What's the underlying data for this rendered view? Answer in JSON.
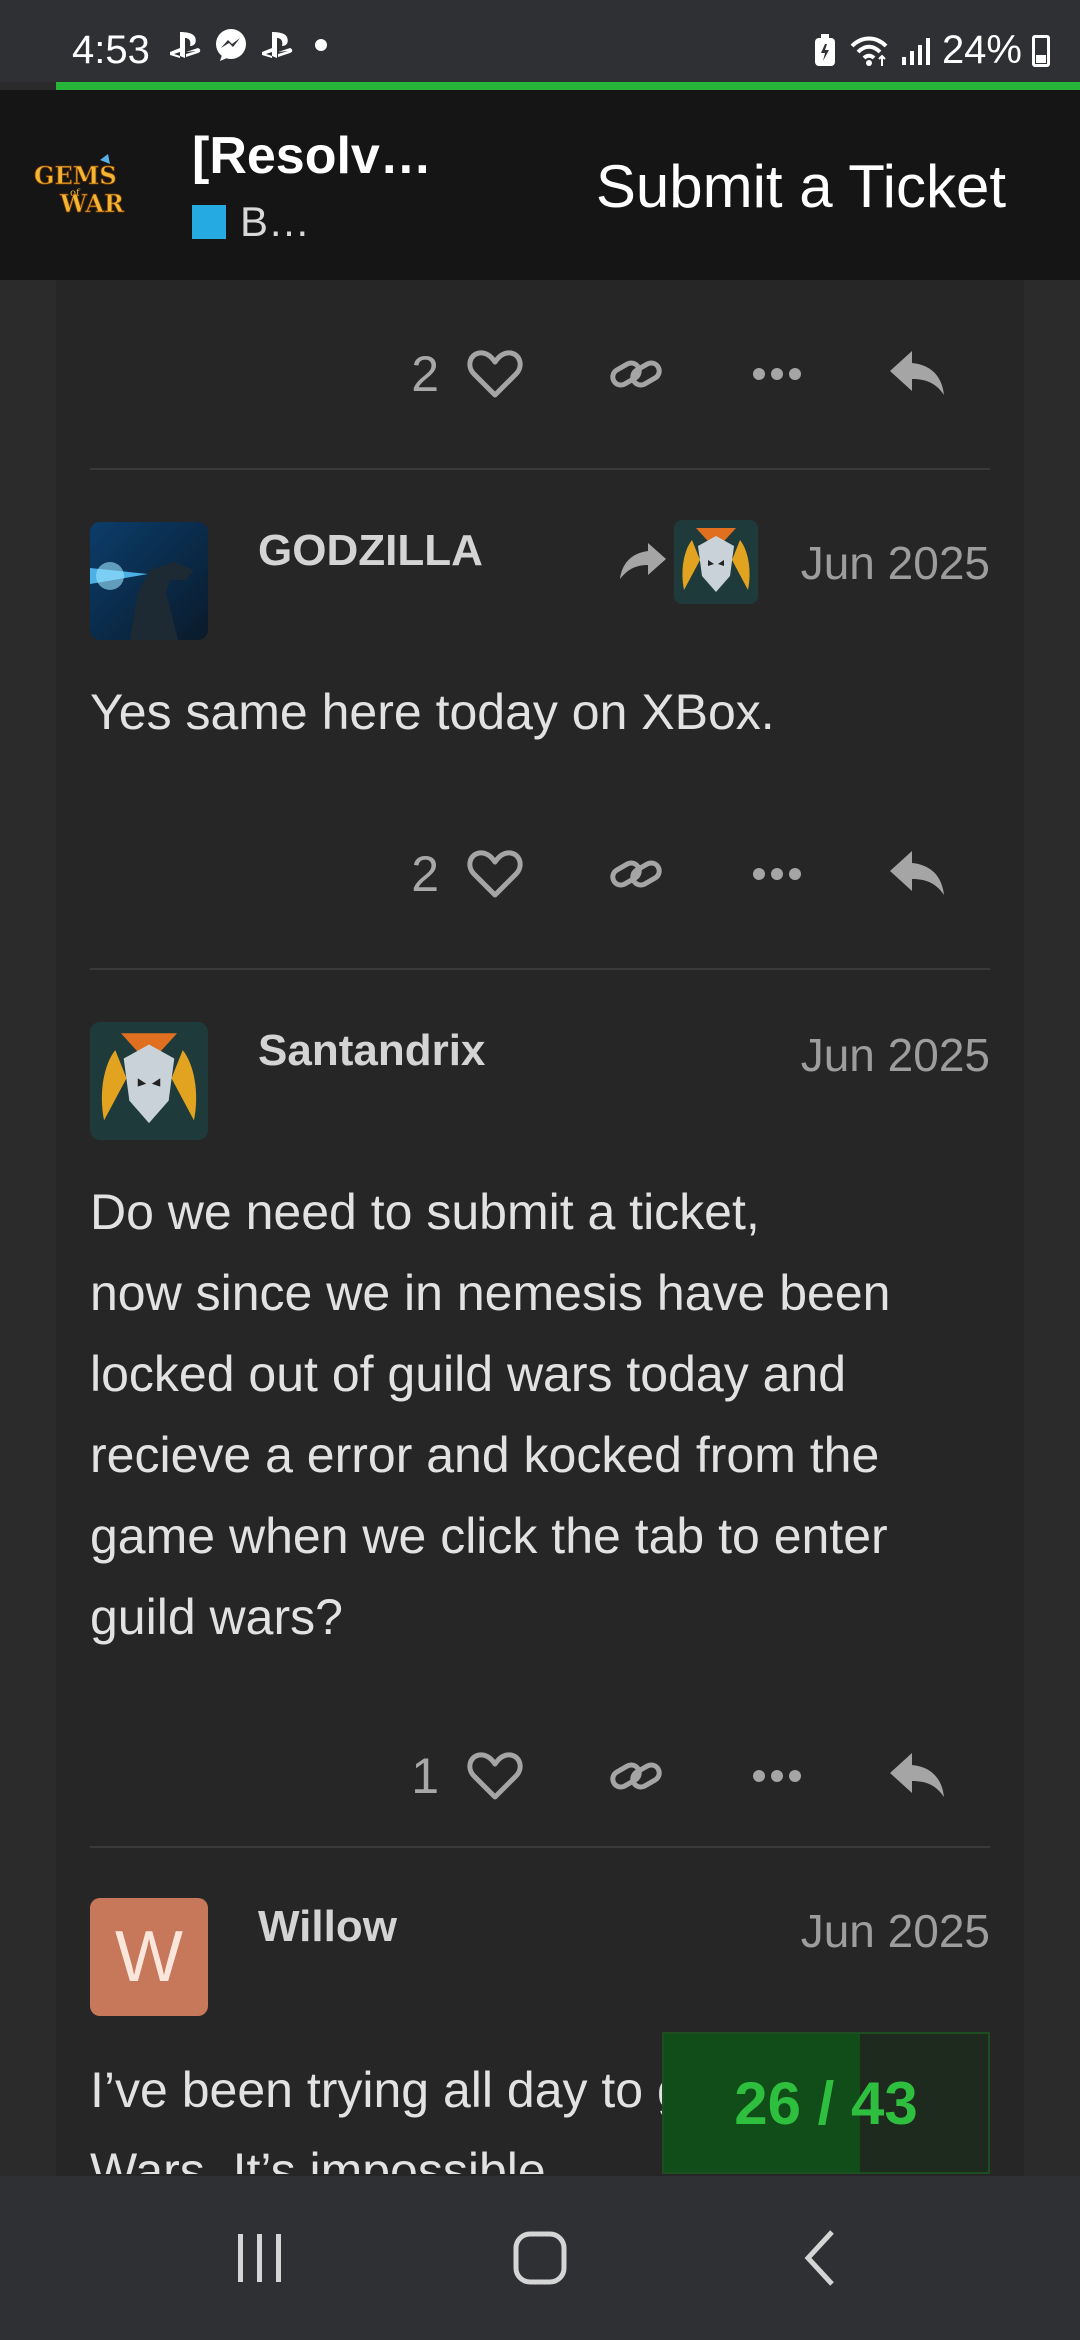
{
  "status_bar": {
    "time": "4:53",
    "left_icons": [
      "playstation-icon",
      "messenger-icon",
      "playstation-icon",
      "dot-icon"
    ],
    "battery_percent": "24%",
    "right_icons": [
      "battery-saver-icon",
      "wifi-icon",
      "signal-icon",
      "battery-icon"
    ]
  },
  "header": {
    "logo_alt": "Gems of War",
    "topic_title": "[Resolve…",
    "category": "B…",
    "category_color": "#25aae1",
    "submit_ticket_label": "Submit a Ticket"
  },
  "posts": [
    {
      "likes": "2"
    },
    {
      "username": "GODZILLA",
      "date": "Jun 2025",
      "body": "Yes same here today on XBox.",
      "likes": "2",
      "reply_to": true
    },
    {
      "username": "Santandrix",
      "date": "Jun 2025",
      "body": "Do we need to submit a ticket,\nnow since we in nemesis have been locked out of guild wars today and recieve a error and kocked from the game when we click the tab to enter guild wars?",
      "likes": "1"
    },
    {
      "username": "Willow",
      "avatar_letter": "W",
      "avatar_color": "#c7775a",
      "date": "Jun 2025",
      "body": "I’ve been trying all day to get into Guild Wars. It’s impossible"
    }
  ],
  "timeline": {
    "label": "26 / 43",
    "current": 26,
    "total": 43
  },
  "nav": [
    "recent-apps-icon",
    "home-icon",
    "back-icon"
  ],
  "colors": {
    "accent_green": "#27b53a",
    "background": "#262626"
  }
}
